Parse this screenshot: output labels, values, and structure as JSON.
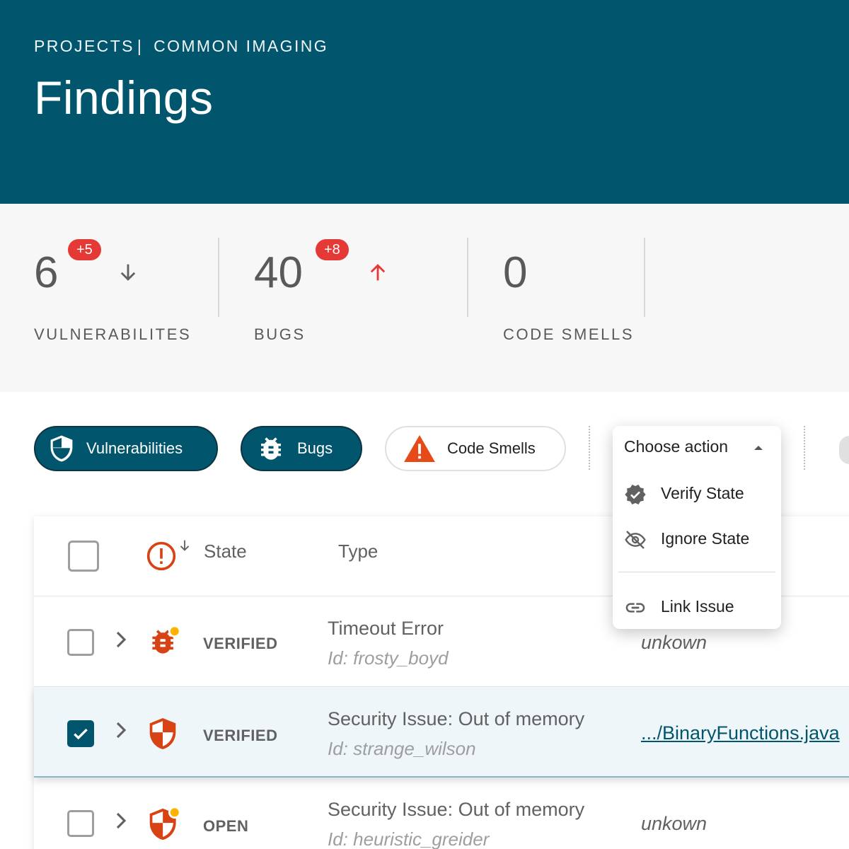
{
  "header": {
    "breadcrumb_root": "PROJECTS",
    "breadcrumb_sep": "|",
    "breadcrumb_project": "COMMON IMAGING",
    "title": "Findings"
  },
  "stats": {
    "vulnerabilities": {
      "count": "6",
      "delta": "+5",
      "label": "VULNERABILITES",
      "trend": "down"
    },
    "bugs": {
      "count": "40",
      "delta": "+8",
      "label": "BUGS",
      "trend": "up"
    },
    "code_smells": {
      "count": "0",
      "label": "CODE SMELLS"
    }
  },
  "filters": {
    "vulnerabilities": {
      "label": "Vulnerabilities",
      "active": true,
      "icon": "shield-icon"
    },
    "bugs": {
      "label": "Bugs",
      "active": true,
      "icon": "bug-icon"
    },
    "code_smells": {
      "label": "Code Smells",
      "active": false,
      "icon": "warning-icon"
    }
  },
  "action_menu": {
    "placeholder": "Choose action",
    "items": [
      {
        "label": "Verify State",
        "icon": "verified-badge-icon"
      },
      {
        "label": "Ignore State",
        "icon": "eye-off-icon"
      },
      {
        "label": "Link Issue",
        "icon": "link-icon"
      }
    ]
  },
  "table": {
    "columns": {
      "state": "State",
      "type": "Type"
    },
    "rows": [
      {
        "state": "VERIFIED",
        "title": "Timeout Error",
        "id": "Id: frosty_boyd",
        "location": "unkown",
        "icon": "bug-icon",
        "checked": false
      },
      {
        "state": "VERIFIED",
        "title": "Security Issue: Out of memory",
        "id": "Id: strange_wilson",
        "location": ".../BinaryFunctions.java",
        "icon": "shield-icon",
        "checked": true
      },
      {
        "state": "OPEN",
        "title": "Security Issue: Out of memory",
        "id": "Id: heuristic_greider",
        "location": "unkown",
        "icon": "shield-icon",
        "checked": false
      }
    ]
  },
  "colors": {
    "brand": "#01566d",
    "alert": "#e53935",
    "severity": "#d84315"
  }
}
